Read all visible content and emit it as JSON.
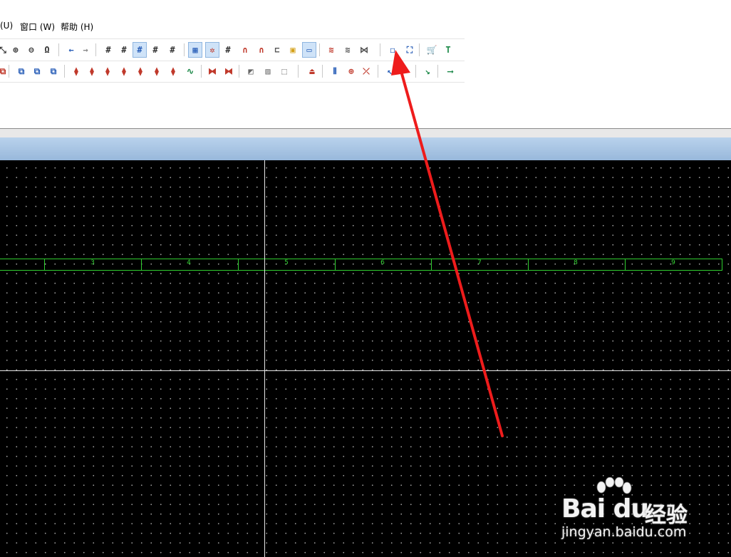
{
  "menu": [
    {
      "label": "(U)"
    },
    {
      "label": "窗口 (W)"
    },
    {
      "label": "帮助 (H)"
    }
  ],
  "toolbar1": [
    {
      "icon": "zoom-area-icon",
      "glyph": "⤡",
      "color": "#333333"
    },
    {
      "icon": "zoom-in-icon",
      "glyph": "⊕",
      "color": "#333333"
    },
    {
      "icon": "zoom-out-icon",
      "glyph": "⊖",
      "color": "#333333"
    },
    {
      "icon": "zoom-100-icon",
      "glyph": "Ω",
      "color": "#333333"
    },
    {
      "icon": "back-arrow-icon",
      "glyph": "←",
      "color": "#2a5fb8"
    },
    {
      "icon": "forward-arrow-icon",
      "glyph": "→",
      "color": "#888888"
    },
    {
      "icon": "grid-a-icon",
      "glyph": "#",
      "color": "#333333"
    },
    {
      "icon": "grid-b-icon",
      "glyph": "#",
      "color": "#333333"
    },
    {
      "icon": "grid-c-icon",
      "glyph": "#",
      "color": "#2a5fb8",
      "active": true
    },
    {
      "icon": "grid-d-icon",
      "glyph": "#",
      "color": "#333333"
    },
    {
      "icon": "grid-e-icon",
      "glyph": "#",
      "color": "#333333"
    },
    {
      "icon": "grid-icon",
      "glyph": "▦",
      "color": "#2a5fb8",
      "active": true
    },
    {
      "icon": "snap-grid-icon",
      "glyph": "✲",
      "color": "#c0392b",
      "active": true
    },
    {
      "icon": "pad-grid-icon",
      "glyph": "#",
      "color": "#333333"
    },
    {
      "icon": "magnet-icon",
      "glyph": "∩",
      "color": "#c0392b"
    },
    {
      "icon": "magnet-attach-icon",
      "glyph": "∩",
      "color": "#c0392b"
    },
    {
      "icon": "connect-icon",
      "glyph": "⊏",
      "color": "#555555"
    },
    {
      "icon": "badge-icon",
      "glyph": "▣",
      "color": "#d4a017"
    },
    {
      "icon": "ruler-icon",
      "glyph": "▭",
      "color": "#2a5fb8",
      "active": true
    },
    {
      "icon": "trace-red-icon",
      "glyph": "≋",
      "color": "#c0392b"
    },
    {
      "icon": "trace-wave-icon",
      "glyph": "≋",
      "color": "#555555"
    },
    {
      "icon": "trace-cross-icon",
      "glyph": "⋈",
      "color": "#555555"
    },
    {
      "icon": "component-select-icon",
      "glyph": "◻",
      "color": "#2a5fb8"
    },
    {
      "icon": "area-select-icon",
      "glyph": "⛶",
      "color": "#2a5fb8"
    },
    {
      "icon": "cart-icon",
      "glyph": "🛒",
      "color": "#2a5fb8"
    },
    {
      "icon": "text-frame-icon",
      "glyph": "T",
      "color": "#1e8a4a"
    }
  ],
  "toolbar2": [
    {
      "icon": "part-icon",
      "glyph": "⧉",
      "color": "#c0392b"
    },
    {
      "icon": "part-group-icon",
      "glyph": "⧉",
      "color": "#2a5fb8"
    },
    {
      "icon": "part-rotate-icon",
      "glyph": "⧉",
      "color": "#2a5fb8"
    },
    {
      "icon": "part-move-icon",
      "glyph": "⧉",
      "color": "#2a5fb8"
    },
    {
      "icon": "net-a-icon",
      "glyph": "⧫",
      "color": "#c0392b"
    },
    {
      "icon": "net-b-icon",
      "glyph": "⧫",
      "color": "#c0392b"
    },
    {
      "icon": "net-c-icon",
      "glyph": "⧫",
      "color": "#c0392b"
    },
    {
      "icon": "net-d-icon",
      "glyph": "⧫",
      "color": "#c0392b"
    },
    {
      "icon": "net-e-icon",
      "glyph": "⧫",
      "color": "#c0392b"
    },
    {
      "icon": "net-f-icon",
      "glyph": "⧫",
      "color": "#c0392b"
    },
    {
      "icon": "net-g-icon",
      "glyph": "⧫",
      "color": "#c0392b"
    },
    {
      "icon": "net-wave-icon",
      "glyph": "∿",
      "color": "#1e8a4a"
    },
    {
      "icon": "pin-swap-icon",
      "glyph": "⧓",
      "color": "#c0392b"
    },
    {
      "icon": "pin-merge-icon",
      "glyph": "⧓",
      "color": "#c0392b"
    },
    {
      "icon": "copper-pour-icon",
      "glyph": "◩",
      "color": "#666666"
    },
    {
      "icon": "hatch-icon",
      "glyph": "▨",
      "color": "#777777"
    },
    {
      "icon": "cutout-icon",
      "glyph": "⬚",
      "color": "#555555"
    },
    {
      "icon": "stack-icon",
      "glyph": "⏏",
      "color": "#c0392b"
    },
    {
      "icon": "via-vertical-icon",
      "glyph": "⦀",
      "color": "#2a5fb8"
    },
    {
      "icon": "via-cross-icon",
      "glyph": "⊕",
      "color": "#c0392b"
    },
    {
      "icon": "via-diagonal-icon",
      "glyph": "⤫",
      "color": "#c0392b"
    },
    {
      "icon": "route-a-icon",
      "glyph": "↖",
      "color": "#2a5fb8"
    },
    {
      "icon": "route-b-icon",
      "glyph": "↔",
      "color": "#2a5fb8"
    },
    {
      "icon": "route-c-icon",
      "glyph": "↘",
      "color": "#1e8a4a"
    },
    {
      "icon": "route-d-icon",
      "glyph": "⟶",
      "color": "#1e8a4a"
    }
  ],
  "zone_labels": [
    "3",
    "4",
    "5",
    "6",
    "7",
    "8",
    "9"
  ],
  "watermark": {
    "brand": "Bai du",
    "cn": "经验",
    "url": "jingyan.baidu.com"
  },
  "colors": {
    "canvas": "#000000",
    "zone_lines": "#2fcf2f",
    "crosshair": "#e8e8e8",
    "annotation": "#ee1c1c"
  }
}
